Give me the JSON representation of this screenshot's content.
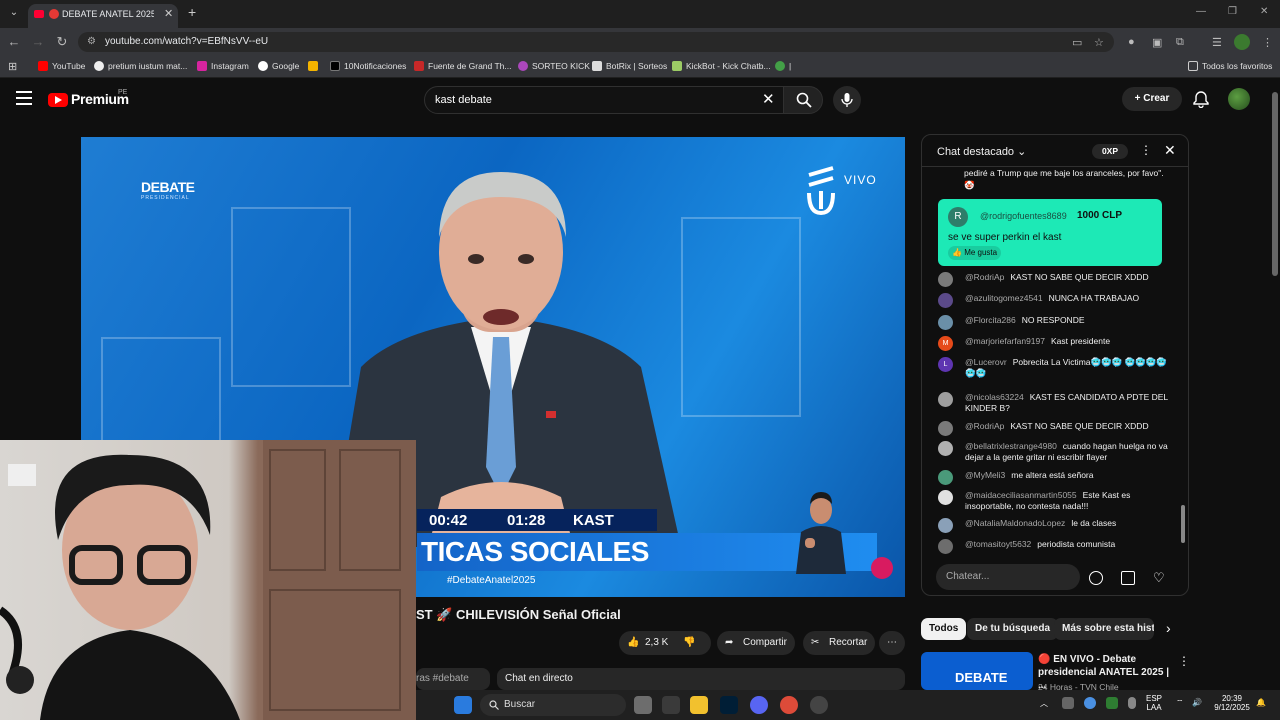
{
  "browser": {
    "tab_title": "DEBATE ANATEL 2025 🎉 E",
    "url": "youtube.com/watch?v=EBfNsVV--eU",
    "bookmarks": [
      "YouTube",
      "pretium iustum mat...",
      "Instagram",
      "Google",
      "10Notificaciones",
      "Fuente de Grand Th...",
      "SORTEO KICK",
      "BotRix | Sorteos",
      "KickBot - Kick Chatb...",
      "|"
    ],
    "all_bookmarks": "Todos los favoritos"
  },
  "header": {
    "logo_text": "Premium",
    "country": "PE",
    "search_value": "kast debate",
    "create_label": "Crear"
  },
  "video": {
    "logo_big": "DEBATE",
    "logo_small": "PRESIDENCIAL",
    "live": "VIVO",
    "timer_left": "00:42",
    "timer_right": "01:28",
    "speaker": "KAST",
    "topic": "TICAS SOCIALES",
    "hashtag": "#DebateAnatel2025",
    "title": "ST 🚀 CHILEVISIÓN Señal Oficial"
  },
  "actions": {
    "likes": "2,3 K",
    "share": "Compartir",
    "clip": "Recortar",
    "tags": "ras #debate",
    "live_chat": "Chat en directo"
  },
  "chat": {
    "header": "Chat destacado",
    "xp": "0XP",
    "prev_message": "pediré a Trump que me baje los aranceles, por favo\". 🤡",
    "super": {
      "avatar": "R",
      "user": "@rodrigofuentes8689",
      "amount": "1000 CLP",
      "message": "se ve super perkin el kast",
      "like": "Me gusta"
    },
    "messages": [
      {
        "user": "@RodriAp",
        "text": "KAST NO SABE QUE DECIR XDDD",
        "initial": "",
        "color": "#7a7a7a"
      },
      {
        "user": "@azulitogomez4541",
        "text": "NUNCA HA TRABAJAO",
        "initial": "",
        "color": "#5b4a8a"
      },
      {
        "user": "@Florcita286",
        "text": "NO RESPONDE",
        "initial": "",
        "color": "#6a8fa8"
      },
      {
        "user": "@marjoriefarfan9197",
        "text": "Kast presidente",
        "initial": "M",
        "color": "#e64a19"
      },
      {
        "user": "@Lucerovr",
        "text": "Pobrecita La Victima🥶🥶🥶 🥶🥶🥶🥶🥶🥶",
        "initial": "L",
        "color": "#5e35b1"
      },
      {
        "user": "@nicolas63224",
        "text": "KAST ES CANDIDATO A PDTE DEL KINDER B?",
        "initial": "",
        "color": "#9e9e9e"
      },
      {
        "user": "@RodriAp",
        "text": "KAST NO SABE QUE DECIR XDDD",
        "initial": "",
        "color": "#7a7a7a"
      },
      {
        "user": "@bellatrixlestrange4980",
        "text": "cuando hagan huelga no va dejar a la gente gritar ni escribir flayer",
        "initial": "",
        "color": "#b0b0b0"
      },
      {
        "user": "@MyMeli3",
        "text": "me altera está señora",
        "initial": "",
        "color": "#4a9a7a"
      },
      {
        "user": "@maidaceciliasanmartin5055",
        "text": "Este Kast es insoportable, no contesta nada!!!",
        "initial": "",
        "color": "#e0e0e0"
      },
      {
        "user": "@NataliaMaldonadoLopez",
        "text": "le da clases",
        "initial": "",
        "color": "#8aa0b8"
      },
      {
        "user": "@tomasitoyt5632",
        "text": "periodista comunista",
        "initial": "",
        "color": "#6d6d6d"
      }
    ],
    "input_placeholder": "Chatear..."
  },
  "chips": [
    "Todos",
    "De tu búsqueda",
    "Más sobre esta histo"
  ],
  "recommendation": {
    "thumb_text": "DEBATE",
    "title": "🔴 EN VIVO - Debate presidencial ANATEL 2025 | ...",
    "channel": "24 Horas - TVN Chile"
  },
  "taskbar": {
    "search": "Buscar",
    "lang_top": "ESP",
    "lang_bottom": "LAA",
    "time": "20:39",
    "date": "9/12/2025"
  }
}
